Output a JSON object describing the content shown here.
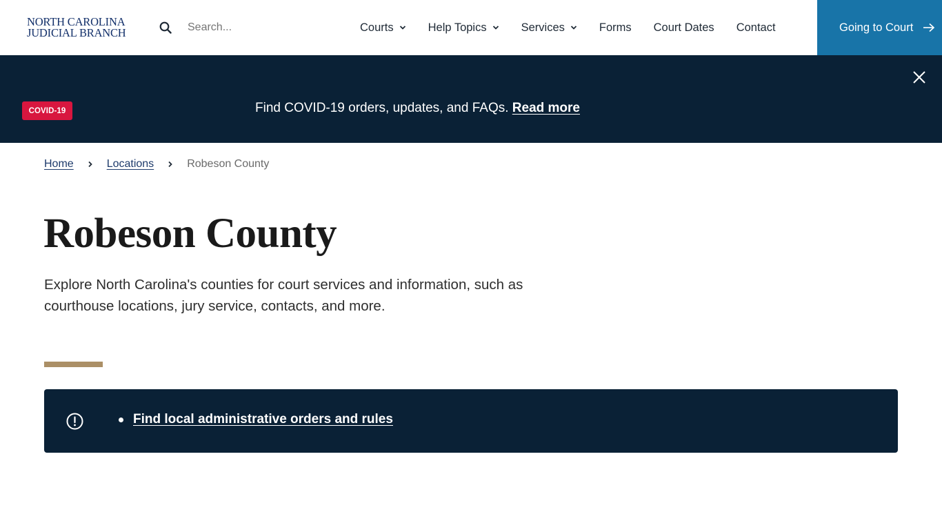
{
  "header": {
    "logo_line1": "NORTH CAROLINA",
    "logo_line2": "JUDICIAL BRANCH",
    "search_placeholder": "Search...",
    "search_value": "",
    "nav": [
      {
        "label": "Courts",
        "has_dropdown": true
      },
      {
        "label": "Help Topics",
        "has_dropdown": true
      },
      {
        "label": "Services",
        "has_dropdown": true
      },
      {
        "label": "Forms",
        "has_dropdown": false
      },
      {
        "label": "Court Dates",
        "has_dropdown": false
      },
      {
        "label": "Contact",
        "has_dropdown": false
      }
    ],
    "cta_label": "Going to Court",
    "cta_icon": "arrow-right-icon"
  },
  "banner": {
    "badge": "COVID-19",
    "text": "Find COVID-19 orders, updates, and FAQs.",
    "link_label": "Read more",
    "close_icon": "close-icon"
  },
  "breadcrumb": {
    "items": [
      {
        "label": "Home",
        "link": true
      },
      {
        "label": "Locations",
        "link": true
      },
      {
        "label": "Robeson County",
        "link": false
      }
    ]
  },
  "main": {
    "title": "Robeson County",
    "intro": "Explore North Carolina's counties for court services and information, such as courthouse locations, jury service, contacts, and more.",
    "alert": {
      "icon": "exclamation-circle-icon",
      "links": [
        "Find local administrative orders and rules"
      ]
    }
  },
  "colors": {
    "brand_navy": "#0a2136",
    "cta_blue": "#1874a8",
    "badge_red": "#d8163f",
    "accent_gold": "#ab8f66",
    "logo_blue": "#13306a"
  }
}
